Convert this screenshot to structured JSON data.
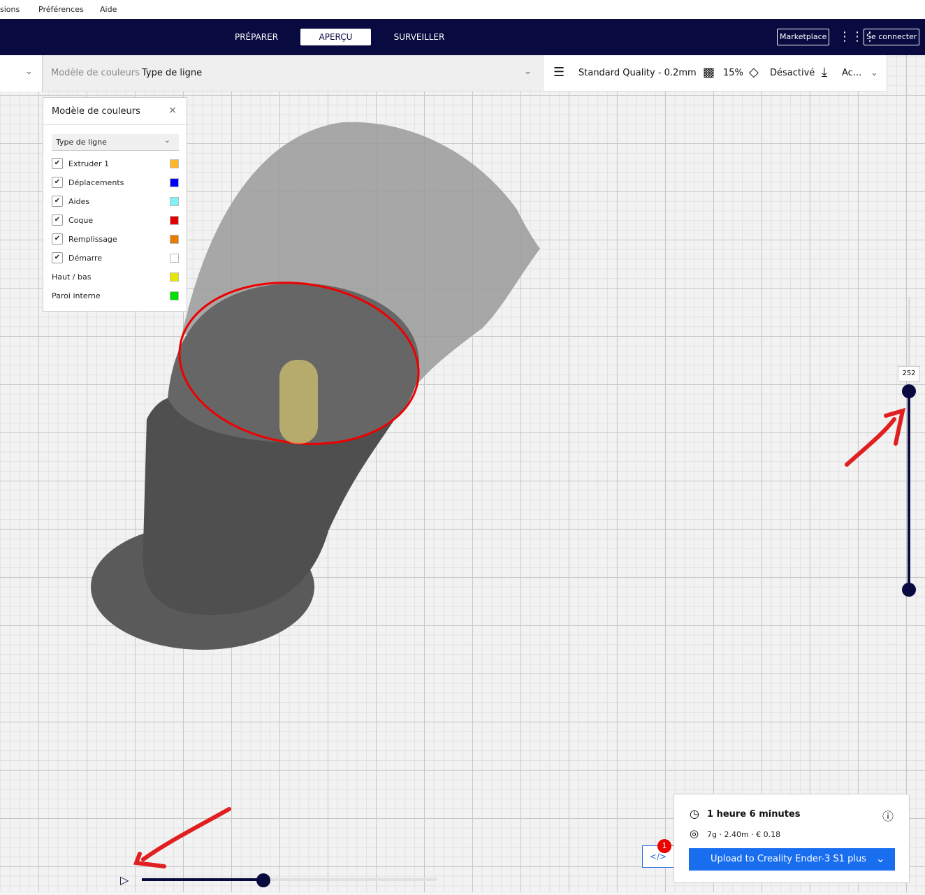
{
  "menu": [
    "sions",
    "Préférences",
    "Aide"
  ],
  "tabs": [
    "PRÉPARER",
    "APERÇU",
    "SURVEILLER"
  ],
  "header": {
    "marketplace": "Marketplace",
    "signin": "Se connecter"
  },
  "subbar": {
    "label": "Modèle de couleurs",
    "value": "Type de ligne"
  },
  "settings": {
    "profile": "Standard Quality - 0.2mm",
    "infill": "15%",
    "support": "Désactivé",
    "adhesion": "Ac..."
  },
  "legend": {
    "title": "Modèle de couleurs",
    "select": "Type de ligne",
    "items": [
      {
        "label": "Extruder 1",
        "checked": true,
        "color": "#fbb62a"
      },
      {
        "label": "Déplacements",
        "checked": true,
        "color": "#0000ff"
      },
      {
        "label": "Aides",
        "checked": true,
        "color": "#80f4f4"
      },
      {
        "label": "Coque",
        "checked": true,
        "color": "#e00000"
      },
      {
        "label": "Remplissage",
        "checked": true,
        "color": "#e87a00"
      },
      {
        "label": "Démarre",
        "checked": true,
        "color": "#ffffff"
      },
      {
        "label": "Haut / bas",
        "checked": false,
        "color": "#e6e600"
      },
      {
        "label": "Paroi interne",
        "checked": false,
        "color": "#00e000"
      }
    ]
  },
  "layer_slider": {
    "value": "252",
    "fraction": 0.67
  },
  "path_slider": {
    "fraction": 0.41
  },
  "print_info": {
    "time": "1 heure 6 minutes",
    "material": "7g · 2.40m · € 0.18",
    "upload": "Upload to Creality Ender-3 S1 plus",
    "badge": "1"
  }
}
